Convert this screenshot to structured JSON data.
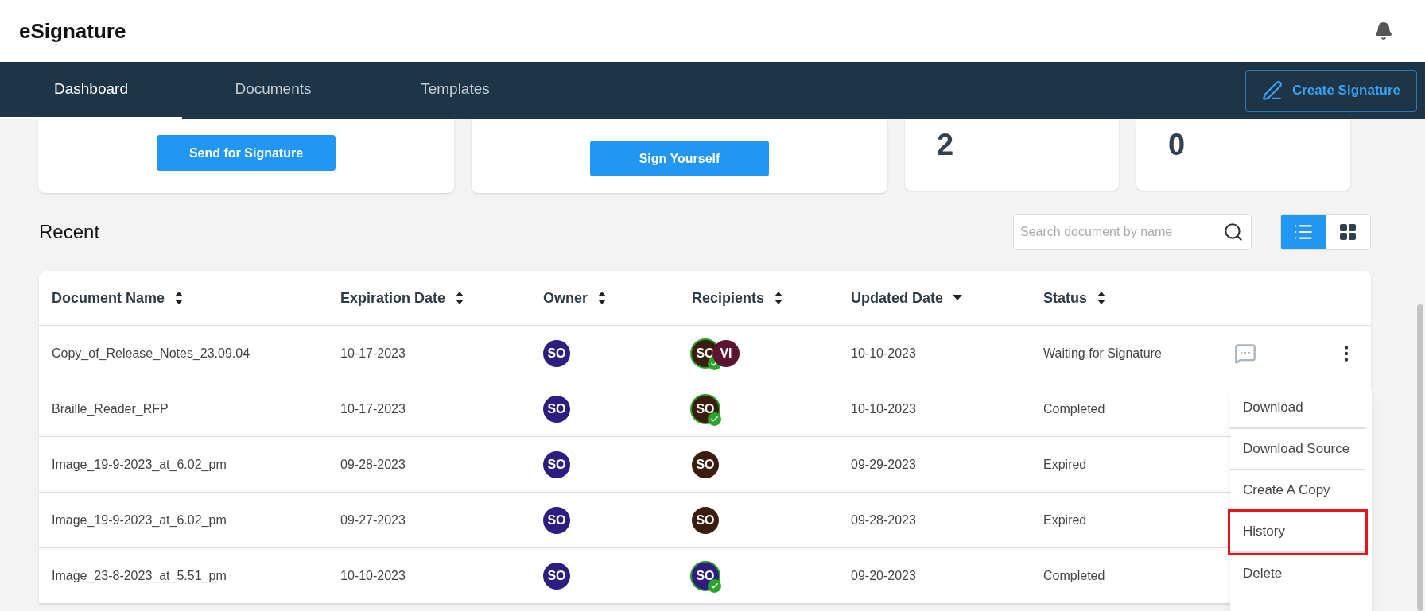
{
  "app_title": "eSignature",
  "nav": {
    "tabs": [
      {
        "label": "Dashboard",
        "selected": true
      },
      {
        "label": "Documents",
        "selected": false
      },
      {
        "label": "Templates",
        "selected": false
      }
    ],
    "action": "Create Signature"
  },
  "cards": [
    {
      "kind": "button",
      "button": "Send for Signature"
    },
    {
      "kind": "button",
      "button": "Sign Yourself"
    },
    {
      "kind": "count",
      "value": "2"
    },
    {
      "kind": "count",
      "value": "0"
    }
  ],
  "recent": {
    "title": "Recent",
    "search": {
      "placeholder": "Search document by name"
    },
    "views": [
      {
        "kind": "list",
        "selected": true
      },
      {
        "kind": "grid",
        "selected": false
      }
    ]
  },
  "table": {
    "columns": [
      {
        "label": "Document Name",
        "kind": "sortable"
      },
      {
        "label": "Expiration Date",
        "kind": "sortable"
      },
      {
        "label": "Owner",
        "kind": "sortable"
      },
      {
        "label": "Recipients",
        "kind": "sortable"
      },
      {
        "label": "Updated Date",
        "kind": "sorted"
      },
      {
        "label": "Status",
        "kind": "sortable"
      }
    ],
    "rows": [
      {
        "name": "Copy_of_Release_Notes_23.09.04",
        "expiration": "10-17-2023",
        "owner": {
          "initials": "SO",
          "color": "#2f1c80"
        },
        "recipients": [
          {
            "initials": "SO",
            "color": "#3b1d0e",
            "signed": true
          },
          {
            "initials": "VI",
            "color": "#5b1530",
            "signed": false
          }
        ],
        "updated": "10-10-2023",
        "status": "Waiting for Signature",
        "hovered": true
      },
      {
        "name": "Braille_Reader_RFP",
        "expiration": "10-17-2023",
        "owner": {
          "initials": "SO",
          "color": "#2f1c80"
        },
        "recipients": [
          {
            "initials": "SO",
            "color": "#3b1d0e",
            "signed": true
          }
        ],
        "updated": "10-10-2023",
        "status": "Completed",
        "hovered": false
      },
      {
        "name": "Image_19-9-2023_at_6.02_pm",
        "expiration": "09-28-2023",
        "owner": {
          "initials": "SO",
          "color": "#2f1c80"
        },
        "recipients": [
          {
            "initials": "SO",
            "color": "#3b1d0e",
            "signed": false
          }
        ],
        "updated": "09-29-2023",
        "status": "Expired",
        "hovered": false
      },
      {
        "name": "Image_19-9-2023_at_6.02_pm",
        "expiration": "09-27-2023",
        "owner": {
          "initials": "SO",
          "color": "#2f1c80"
        },
        "recipients": [
          {
            "initials": "SO",
            "color": "#3b1d0e",
            "signed": false
          }
        ],
        "updated": "09-28-2023",
        "status": "Expired",
        "hovered": false
      },
      {
        "name": "Image_23-8-2023_at_5.51_pm",
        "expiration": "10-10-2023",
        "owner": {
          "initials": "SO",
          "color": "#2f1c80"
        },
        "recipients": [
          {
            "initials": "SO",
            "color": "#2f1c80",
            "signed": true
          }
        ],
        "updated": "09-20-2023",
        "status": "Completed",
        "hovered": false
      }
    ]
  },
  "menu": [
    {
      "label": "Download",
      "highlighted": false
    },
    {
      "label": "Download Source",
      "highlighted": false
    },
    {
      "label": "Create A Copy",
      "highlighted": false
    },
    {
      "label": "History",
      "highlighted": true
    },
    {
      "label": "Delete",
      "highlighted": false
    }
  ]
}
